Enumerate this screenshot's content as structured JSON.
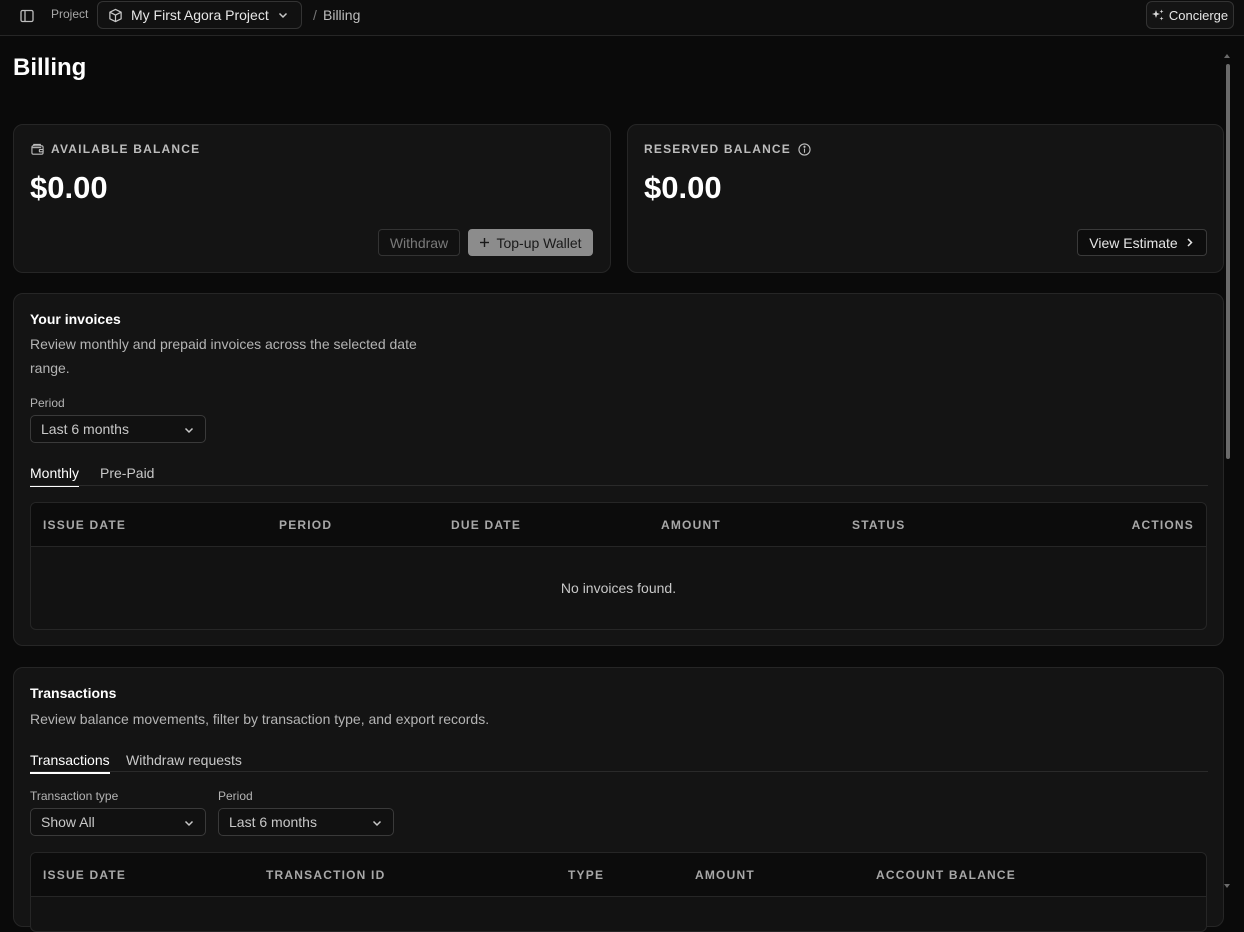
{
  "topbar": {
    "project_label": "Project",
    "project_name": "My First Agora Project",
    "separator": "/",
    "current_page": "Billing",
    "concierge_label": "Concierge"
  },
  "page": {
    "title": "Billing"
  },
  "available_balance": {
    "label": "AVAILABLE BALANCE",
    "amount": "$0.00",
    "withdraw_label": "Withdraw",
    "topup_label": "Top-up Wallet"
  },
  "reserved_balance": {
    "label": "RESERVED BALANCE",
    "amount": "$0.00",
    "estimate_label": "View Estimate"
  },
  "invoices": {
    "title": "Your invoices",
    "description_line1": "Review monthly and prepaid invoices across the selected date",
    "description_line2": "range.",
    "period_label": "Period",
    "period_value": "Last 6 months",
    "tabs": [
      {
        "label": "Monthly",
        "active": true
      },
      {
        "label": "Pre-Paid",
        "active": false
      }
    ],
    "columns": [
      "ISSUE DATE",
      "PERIOD",
      "DUE DATE",
      "AMOUNT",
      "STATUS",
      "ACTIONS"
    ],
    "empty_message": "No invoices found."
  },
  "transactions": {
    "title": "Transactions",
    "description": "Review balance movements, filter by transaction type, and export records.",
    "tabs": [
      {
        "label": "Transactions",
        "active": true
      },
      {
        "label": "Withdraw requests",
        "active": false
      }
    ],
    "type_label": "Transaction type",
    "type_value": "Show All",
    "period_label": "Period",
    "period_value": "Last 6 months",
    "columns": [
      "ISSUE DATE",
      "TRANSACTION ID",
      "TYPE",
      "AMOUNT",
      "ACCOUNT BALANCE"
    ]
  },
  "icons": {
    "sidebar_toggle": "sidebar-toggle-icon",
    "project": "cube-icon",
    "chevron": "chevron-down-icon",
    "concierge": "sparkles-icon",
    "wallet": "wallet-icon",
    "info": "info-icon",
    "plus": "plus-icon",
    "chevron_right": "chevron-right-icon"
  }
}
